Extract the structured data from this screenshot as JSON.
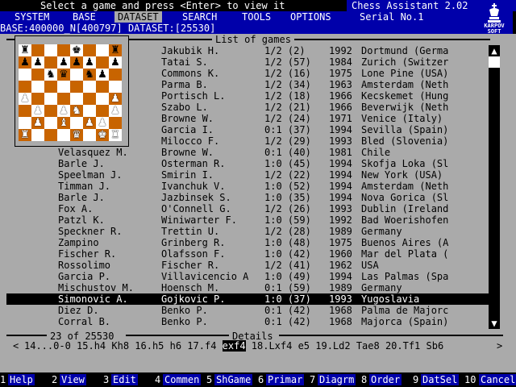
{
  "topbar": {
    "prompt": "Select a game and press <Enter> to view it"
  },
  "app": {
    "title": "Chess Assistant 2.02",
    "serial": "Serial No.1",
    "logo_text_1": "KARPOV",
    "logo_text_2": "SOFT"
  },
  "menu": [
    {
      "label": "SYSTEM"
    },
    {
      "label": "BASE"
    },
    {
      "label": "DATASET",
      "active": true
    },
    {
      "label": "SEARCH"
    },
    {
      "label": "TOOLS"
    },
    {
      "label": "OPTIONS"
    }
  ],
  "status": {
    "text": "BASE:400000_N[400797] DATASET:[25530]"
  },
  "list": {
    "title": "List of games",
    "rows": [
      {
        "white": "",
        "black": "Jakubik H.",
        "result": "1/2 (2)",
        "year": "1992",
        "place": "Dortmund (Germa"
      },
      {
        "white": "",
        "black": "Tatai S.",
        "result": "1/2 (57)",
        "year": "1984",
        "place": "Zurich (Switzer"
      },
      {
        "white": "",
        "black": "Commons K.",
        "result": "1/2 (16)",
        "year": "1975",
        "place": "Lone Pine (USA)"
      },
      {
        "white": "J.",
        "black": "Parma B.",
        "result": "1/2 (34)",
        "year": "1963",
        "place": "Amsterdam (Neth"
      },
      {
        "white": "",
        "black": "Portisch L.",
        "result": "1/2 (18)",
        "year": "1966",
        "place": "Kecskemet (Hung"
      },
      {
        "white": "",
        "black": "Szabo L.",
        "result": "1/2 (21)",
        "year": "1966",
        "place": "Beverwijk (Neth"
      },
      {
        "white": "",
        "black": "Browne W.",
        "result": "1/2 (24)",
        "year": "1971",
        "place": "Venice (Italy)"
      },
      {
        "white": "ma",
        "black": "Garcia I.",
        "result": "0:1 (37)",
        "year": "1994",
        "place": "Sevilla (Spain)"
      },
      {
        "white": "",
        "black": "Milocco F.",
        "result": "1/2 (29)",
        "year": "1993",
        "place": "Bled (Slovenia)"
      },
      {
        "white": "Velasquez M.",
        "black": "Browne W.",
        "result": "0:1 (40)",
        "year": "1981",
        "place": "Chile"
      },
      {
        "white": "Barle J.",
        "black": "Osterman R.",
        "result": "1:0 (45)",
        "year": "1994",
        "place": "Skofja Loka (Sl"
      },
      {
        "white": "Speelman J.",
        "black": "Smirin I.",
        "result": "1/2 (22)",
        "year": "1994",
        "place": "New York (USA)"
      },
      {
        "white": "Timman J.",
        "black": "Ivanchuk V.",
        "result": "1:0 (52)",
        "year": "1994",
        "place": "Amsterdam (Neth"
      },
      {
        "white": "Barle J.",
        "black": "Jazbinsek S.",
        "result": "1:0 (35)",
        "year": "1994",
        "place": "Nova Gorica (Sl"
      },
      {
        "white": "Fox A.",
        "black": "O'Connell G.",
        "result": "1/2 (26)",
        "year": "1993",
        "place": "Dublin (Ireland"
      },
      {
        "white": "Patzl K.",
        "black": "Winiwarter F.",
        "result": "1:0 (59)",
        "year": "1992",
        "place": "Bad Woerishofen"
      },
      {
        "white": "Speckner R.",
        "black": "Trettin U.",
        "result": "1/2 (28)",
        "year": "1989",
        "place": "Germany"
      },
      {
        "white": "Zampino",
        "black": "Grinberg R.",
        "result": "1:0 (48)",
        "year": "1975",
        "place": "Buenos Aires (A"
      },
      {
        "white": "Fischer R.",
        "black": "Olafsson F.",
        "result": "1:0 (42)",
        "year": "1960",
        "place": "Mar del Plata ("
      },
      {
        "white": "Rossolimo",
        "black": "Fischer R.",
        "result": "1/2 (41)",
        "year": "1962",
        "place": "USA"
      },
      {
        "white": "Garcia P.",
        "black": "Villavicencio A",
        "result": "1:0 (49)",
        "year": "1994",
        "place": "Las Palmas (Spa"
      },
      {
        "white": "Mischustov M.",
        "black": "Hoensch M.",
        "result": "0:1 (59)",
        "year": "1989",
        "place": "Germany"
      },
      {
        "white": "Simonovic A.",
        "black": "Gojkovic P.",
        "result": "1:0 (37)",
        "year": "1993",
        "place": "Yugoslavia",
        "selected": true
      },
      {
        "white": "Diez D.",
        "black": "Benko P.",
        "result": "0:1 (42)",
        "year": "1968",
        "place": "Palma de Majorc"
      },
      {
        "white": "Corral B.",
        "black": "Benko P.",
        "result": "0:1 (42)",
        "year": "1968",
        "place": "Majorca (Spain)"
      }
    ]
  },
  "scrollbar": {
    "up": "▲",
    "down": "▼"
  },
  "board": {
    "ranks": [
      [
        "bR",
        "",
        "",
        "",
        "bK",
        "",
        "",
        "bR"
      ],
      [
        "bP",
        "bP",
        "",
        "bP",
        "bP",
        "bP",
        "",
        "bP"
      ],
      [
        "",
        "",
        "bN",
        "bQ",
        "",
        "bN",
        "bP",
        ""
      ],
      [
        "",
        "",
        "",
        "",
        "",
        "",
        "",
        ""
      ],
      [
        "wP",
        "",
        "",
        "",
        "",
        "",
        "",
        "wP"
      ],
      [
        "",
        "wP",
        "",
        "wP",
        "wN",
        "",
        "",
        "wP"
      ],
      [
        "",
        "wP",
        "",
        "wB",
        "",
        "wP",
        "wP",
        ""
      ],
      [
        "wR",
        "",
        "",
        "",
        "wQ",
        "",
        "wK",
        "wR"
      ]
    ]
  },
  "details": {
    "count": "23 of 25530",
    "title": "Details",
    "moves_before": "14...0-0 15.h4 Kh8 16.h5 h6 17.f4 ",
    "current_move": "exf4",
    "moves_after": " 18.Lxf4 e5 19.Ld2 Tae8 20.Tf1 Sb6",
    "arrow_left": "<",
    "arrow_right": ">"
  },
  "fkeys": [
    {
      "num": "1",
      "label": "Help"
    },
    {
      "num": "2",
      "label": "View"
    },
    {
      "num": "3",
      "label": "Edit"
    },
    {
      "num": "4",
      "label": "Commen"
    },
    {
      "num": "5",
      "label": "ShGame"
    },
    {
      "num": "6",
      "label": "Primar"
    },
    {
      "num": "7",
      "label": "Diagrm"
    },
    {
      "num": "8",
      "label": "Order"
    },
    {
      "num": "9",
      "label": "DatSel"
    },
    {
      "num": "10",
      "label": "Cancel"
    }
  ]
}
